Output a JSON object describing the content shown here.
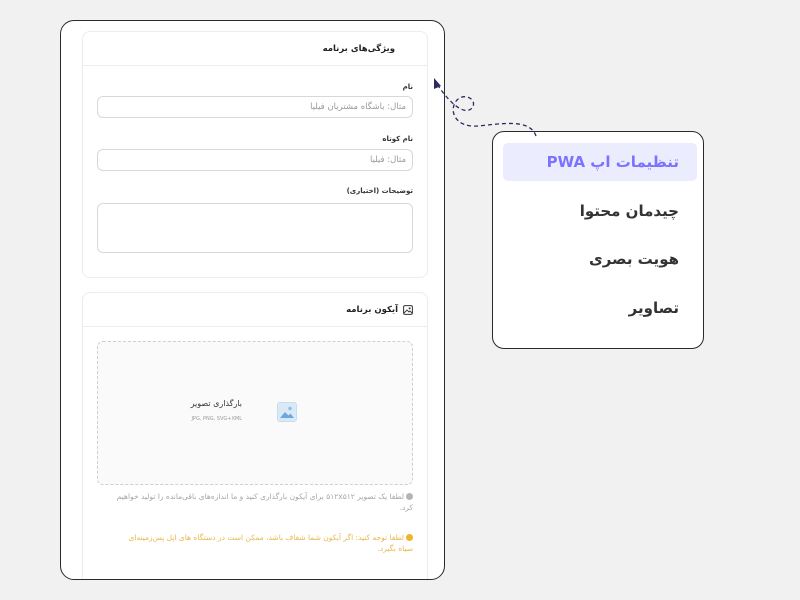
{
  "app_features": {
    "title": "ویژگی‌های برنامه",
    "name_label": "نام",
    "name_placeholder": "مثال: باشگاه مشتریان فیلیا",
    "short_name_label": "نام کوتاه",
    "short_name_placeholder": "مثال: فیلیا",
    "description_label": "توضیحات (اختیاری)"
  },
  "app_icon": {
    "title": "آیکون برنامه",
    "upload_title": "بارگذاری تصویر",
    "upload_formats": "JPG, PNG, SVG+XML",
    "info_hint": "لطفا یک تصویر ۵۱۲x۵۱۲ برای آیکون بارگذاری کنید و ما اندازه‌های باقی‌مانده را تولید خواهیم کرد.",
    "warning_hint": "لطفا توجه کنید: اگر آیکون شما شفاف باشد، ممکن است در دستگاه های اپل پس‌زمینه‌ای سیاه بگیرد."
  },
  "menu": {
    "items": [
      {
        "label": "تنظیمات اپ PWA",
        "active": true
      },
      {
        "label": "چیدمان محتوا",
        "active": false
      },
      {
        "label": "هویت بصری",
        "active": false
      },
      {
        "label": "تصاویر",
        "active": false
      }
    ]
  },
  "colors": {
    "accent": "#7b73ff",
    "active_bg": "#ececff",
    "warning": "#f0b429",
    "connector": "#2c2a5e"
  }
}
